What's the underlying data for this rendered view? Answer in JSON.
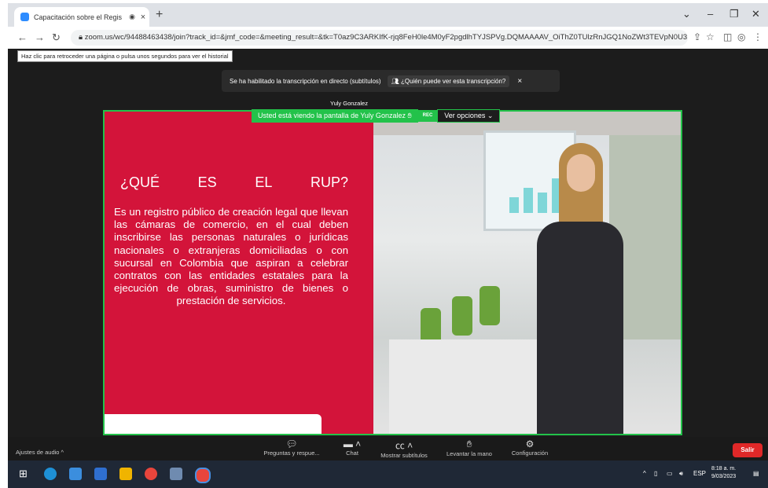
{
  "browser": {
    "tab_title": "Capacitación sobre el Regis",
    "tab_close": "×",
    "new_tab": "+",
    "url": "zoom.us/wc/94488463438/join?track_id=&jmf_code=&meeting_result=&tk=T0az9C3ARKIfK-rjq8FeH0le4M0yF2pgdlhTYJSPVg.DQMAAAAV_OiThZ0TUlzRnJGQ1NoZWt3TEVpN0U3...",
    "tooltip": "Haz clic para retroceder una página o pulsa unos segundos para ver el historial"
  },
  "meeting": {
    "notice_text": "Se ha habilitado la transcripción en directo (subtítulos)",
    "notice_button": "¿Quién puede ver esta transcripción?",
    "notice_close": "×",
    "speaker_name": "Yuly Gonzalez",
    "viewing_text": "Usted está viendo la pantalla de Yuly Gonzalez",
    "rec_label": "REC",
    "view_options": "Ver opciones ⌄"
  },
  "slide": {
    "heading_words": [
      "¿QUÉ",
      "ES",
      "EL",
      "RUP?"
    ],
    "body": "Es un registro público de creación legal que llevan las cámaras de comercio, en el cual deben inscribirse las personas naturales o jurídicas nacionales o extranjeras domiciliadas o con sucursal en Colombia que aspiran a celebrar contratos con las entidades estatales para la ejecución de obras, suministro de bienes o prestación de servicios."
  },
  "controls": {
    "audio_settings": "Ajustes de audio ^",
    "buttons": [
      {
        "label": "Preguntas y respue...",
        "icon": "qa-icon"
      },
      {
        "label": "Chat",
        "icon": "chat-icon"
      },
      {
        "label": "Mostrar subtítulos",
        "icon": "cc-icon"
      },
      {
        "label": "Levantar la mano",
        "icon": "raise-hand-icon"
      },
      {
        "label": "Configuración",
        "icon": "gear-icon"
      }
    ],
    "leave": "Salir"
  },
  "taskbar": {
    "lang": "ESP",
    "time": "8:18 a. m.",
    "date": "9/03/2023"
  },
  "colors": {
    "zoom_green": "#23c24a",
    "slide_red": "#d3143a",
    "leave_red": "#e02828"
  }
}
